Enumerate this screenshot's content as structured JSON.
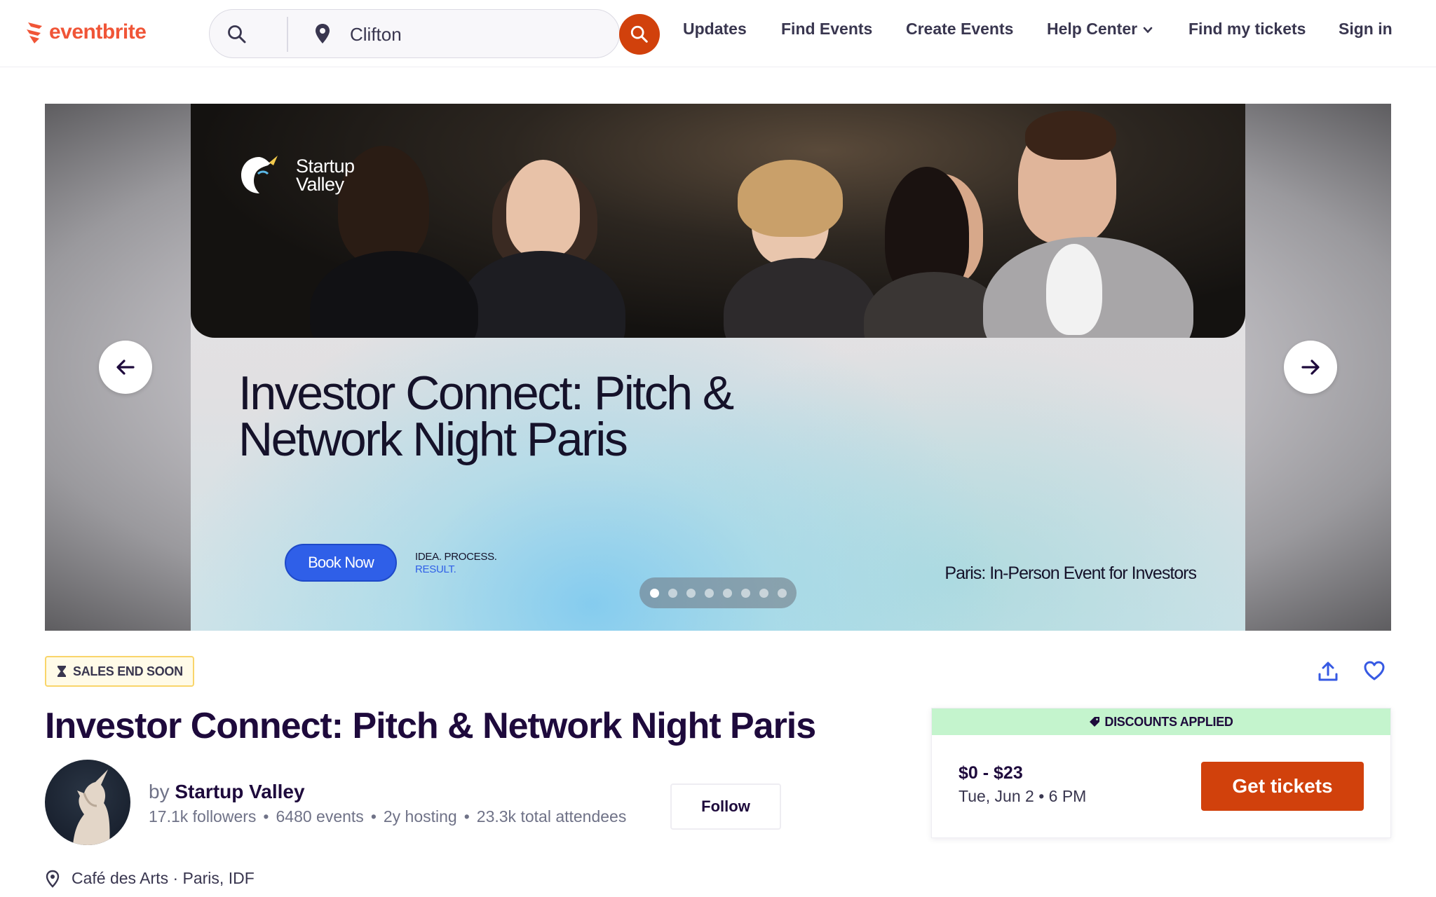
{
  "header": {
    "logo_text": "eventbrite",
    "location_value": "Clifton",
    "nav": {
      "updates": "Updates",
      "find_events": "Find Events",
      "create_events": "Create Events",
      "help_center": "Help Center",
      "find_tickets": "Find my tickets",
      "sign_in": "Sign in"
    }
  },
  "hero": {
    "brand_line1": "Startup",
    "brand_line2": "Valley",
    "title": "Investor Connect: Pitch & Network Night Paris",
    "book_now": "Book Now",
    "tagline_line1": "IDEA. PROCESS.",
    "tagline_line2": "RESULT.",
    "subtitle": "Paris: In-Person Event for Investors",
    "slides_total": 8,
    "active_slide": 1
  },
  "event": {
    "badge": "SALES END SOON",
    "title": "Investor Connect: Pitch & Network Night Paris",
    "organizer": {
      "by": "by",
      "name": "Startup Valley",
      "followers": "17.1k followers",
      "events": "6480 events",
      "hosting": "2y hosting",
      "attendees": "23.3k total attendees",
      "follow_label": "Follow"
    },
    "venue": "Café des Arts · Paris, IDF"
  },
  "ticket_card": {
    "discount_label": "DISCOUNTS APPLIED",
    "price": "$0 - $23",
    "date_time": "Tue, Jun 2 • 6 PM",
    "cta": "Get tickets"
  },
  "colors": {
    "brand_orange": "#f05537",
    "cta": "#d1410c",
    "discount_bg": "#c4f4cd",
    "badge_border": "#f9d56a",
    "book_now_blue": "#2f5fe8",
    "icon_blue": "#3659e3"
  }
}
